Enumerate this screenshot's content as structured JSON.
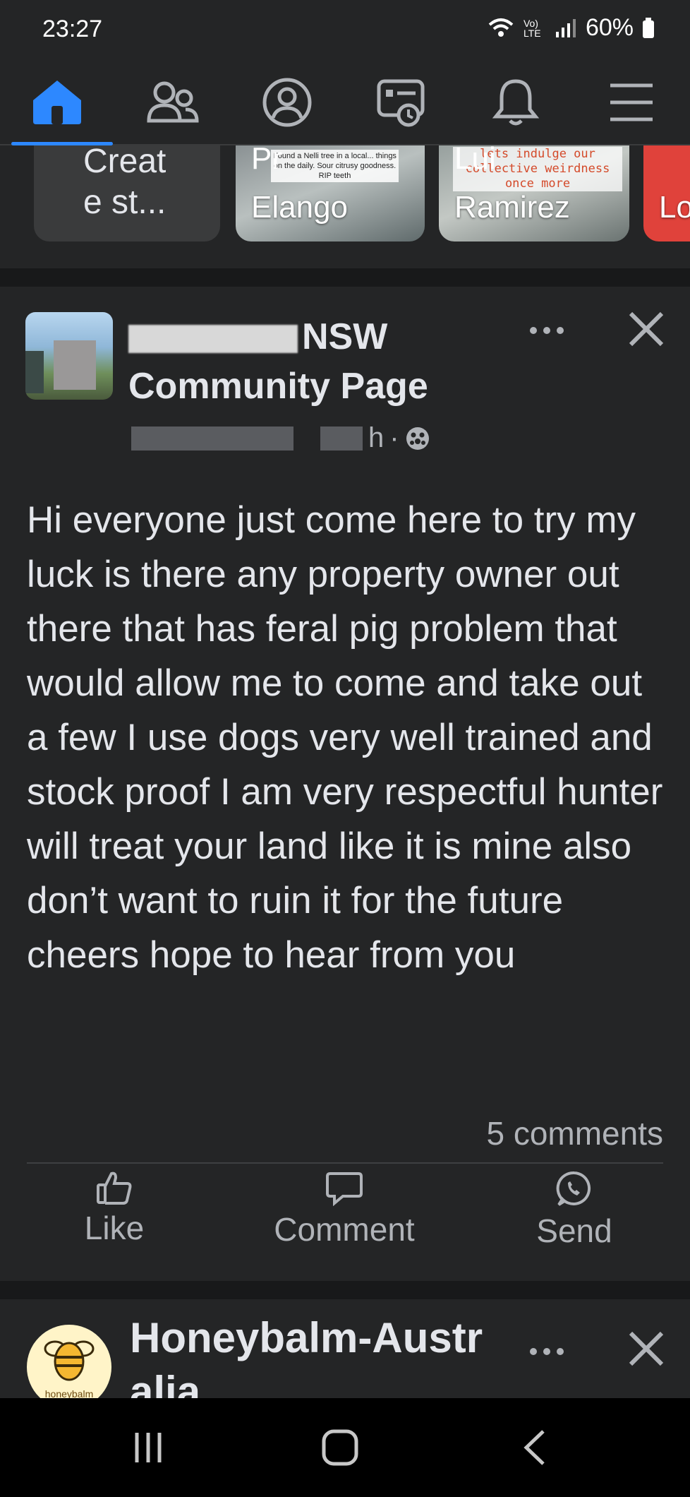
{
  "status_bar": {
    "time": "23:27",
    "battery_percent": "60%",
    "network_label": "Vo) LTE"
  },
  "nav": {
    "items": [
      {
        "name": "home",
        "icon": "home-icon",
        "active": true
      },
      {
        "name": "friends",
        "icon": "friends-icon"
      },
      {
        "name": "profile",
        "icon": "profile-icon"
      },
      {
        "name": "feeds",
        "icon": "feeds-icon"
      },
      {
        "name": "notifications",
        "icon": "bell-icon"
      },
      {
        "name": "menu",
        "icon": "hamburger-icon"
      }
    ],
    "accent_color": "#2d88ff"
  },
  "stories": {
    "create_label": "Creat\ne st...",
    "items": [
      {
        "name_top": "Pr",
        "name_bottom": "Elango",
        "caption": "Found a Nelli tree in a local... things on the daily. Sour citrusy goodness. RIP teeth"
      },
      {
        "name_top": "Lui",
        "name_bottom": "Ramirez",
        "caption": "lets indulge our collective weirdness once more"
      },
      {
        "name_bottom": "Lo"
      }
    ]
  },
  "post": {
    "page_name_visible": "NSW",
    "page_name_line2": "Community Page",
    "time_suffix": "h",
    "dot_separator": "·",
    "body": "Hi everyone just come here to try my luck is there any property owner out there that has feral pig problem that would allow me to come and take out a few I use dogs very well trained and stock proof I am very respectful hunter will treat your land like it is mine also don’t want to ruin it for the future cheers hope to hear from you",
    "comments_count": "5 comments",
    "actions": {
      "like": "Like",
      "comment": "Comment",
      "send": "Send"
    }
  },
  "post2": {
    "page_name": "Honeybalm-Austr",
    "page_name_tail": "alia",
    "avatar_label": "honeybalm"
  }
}
